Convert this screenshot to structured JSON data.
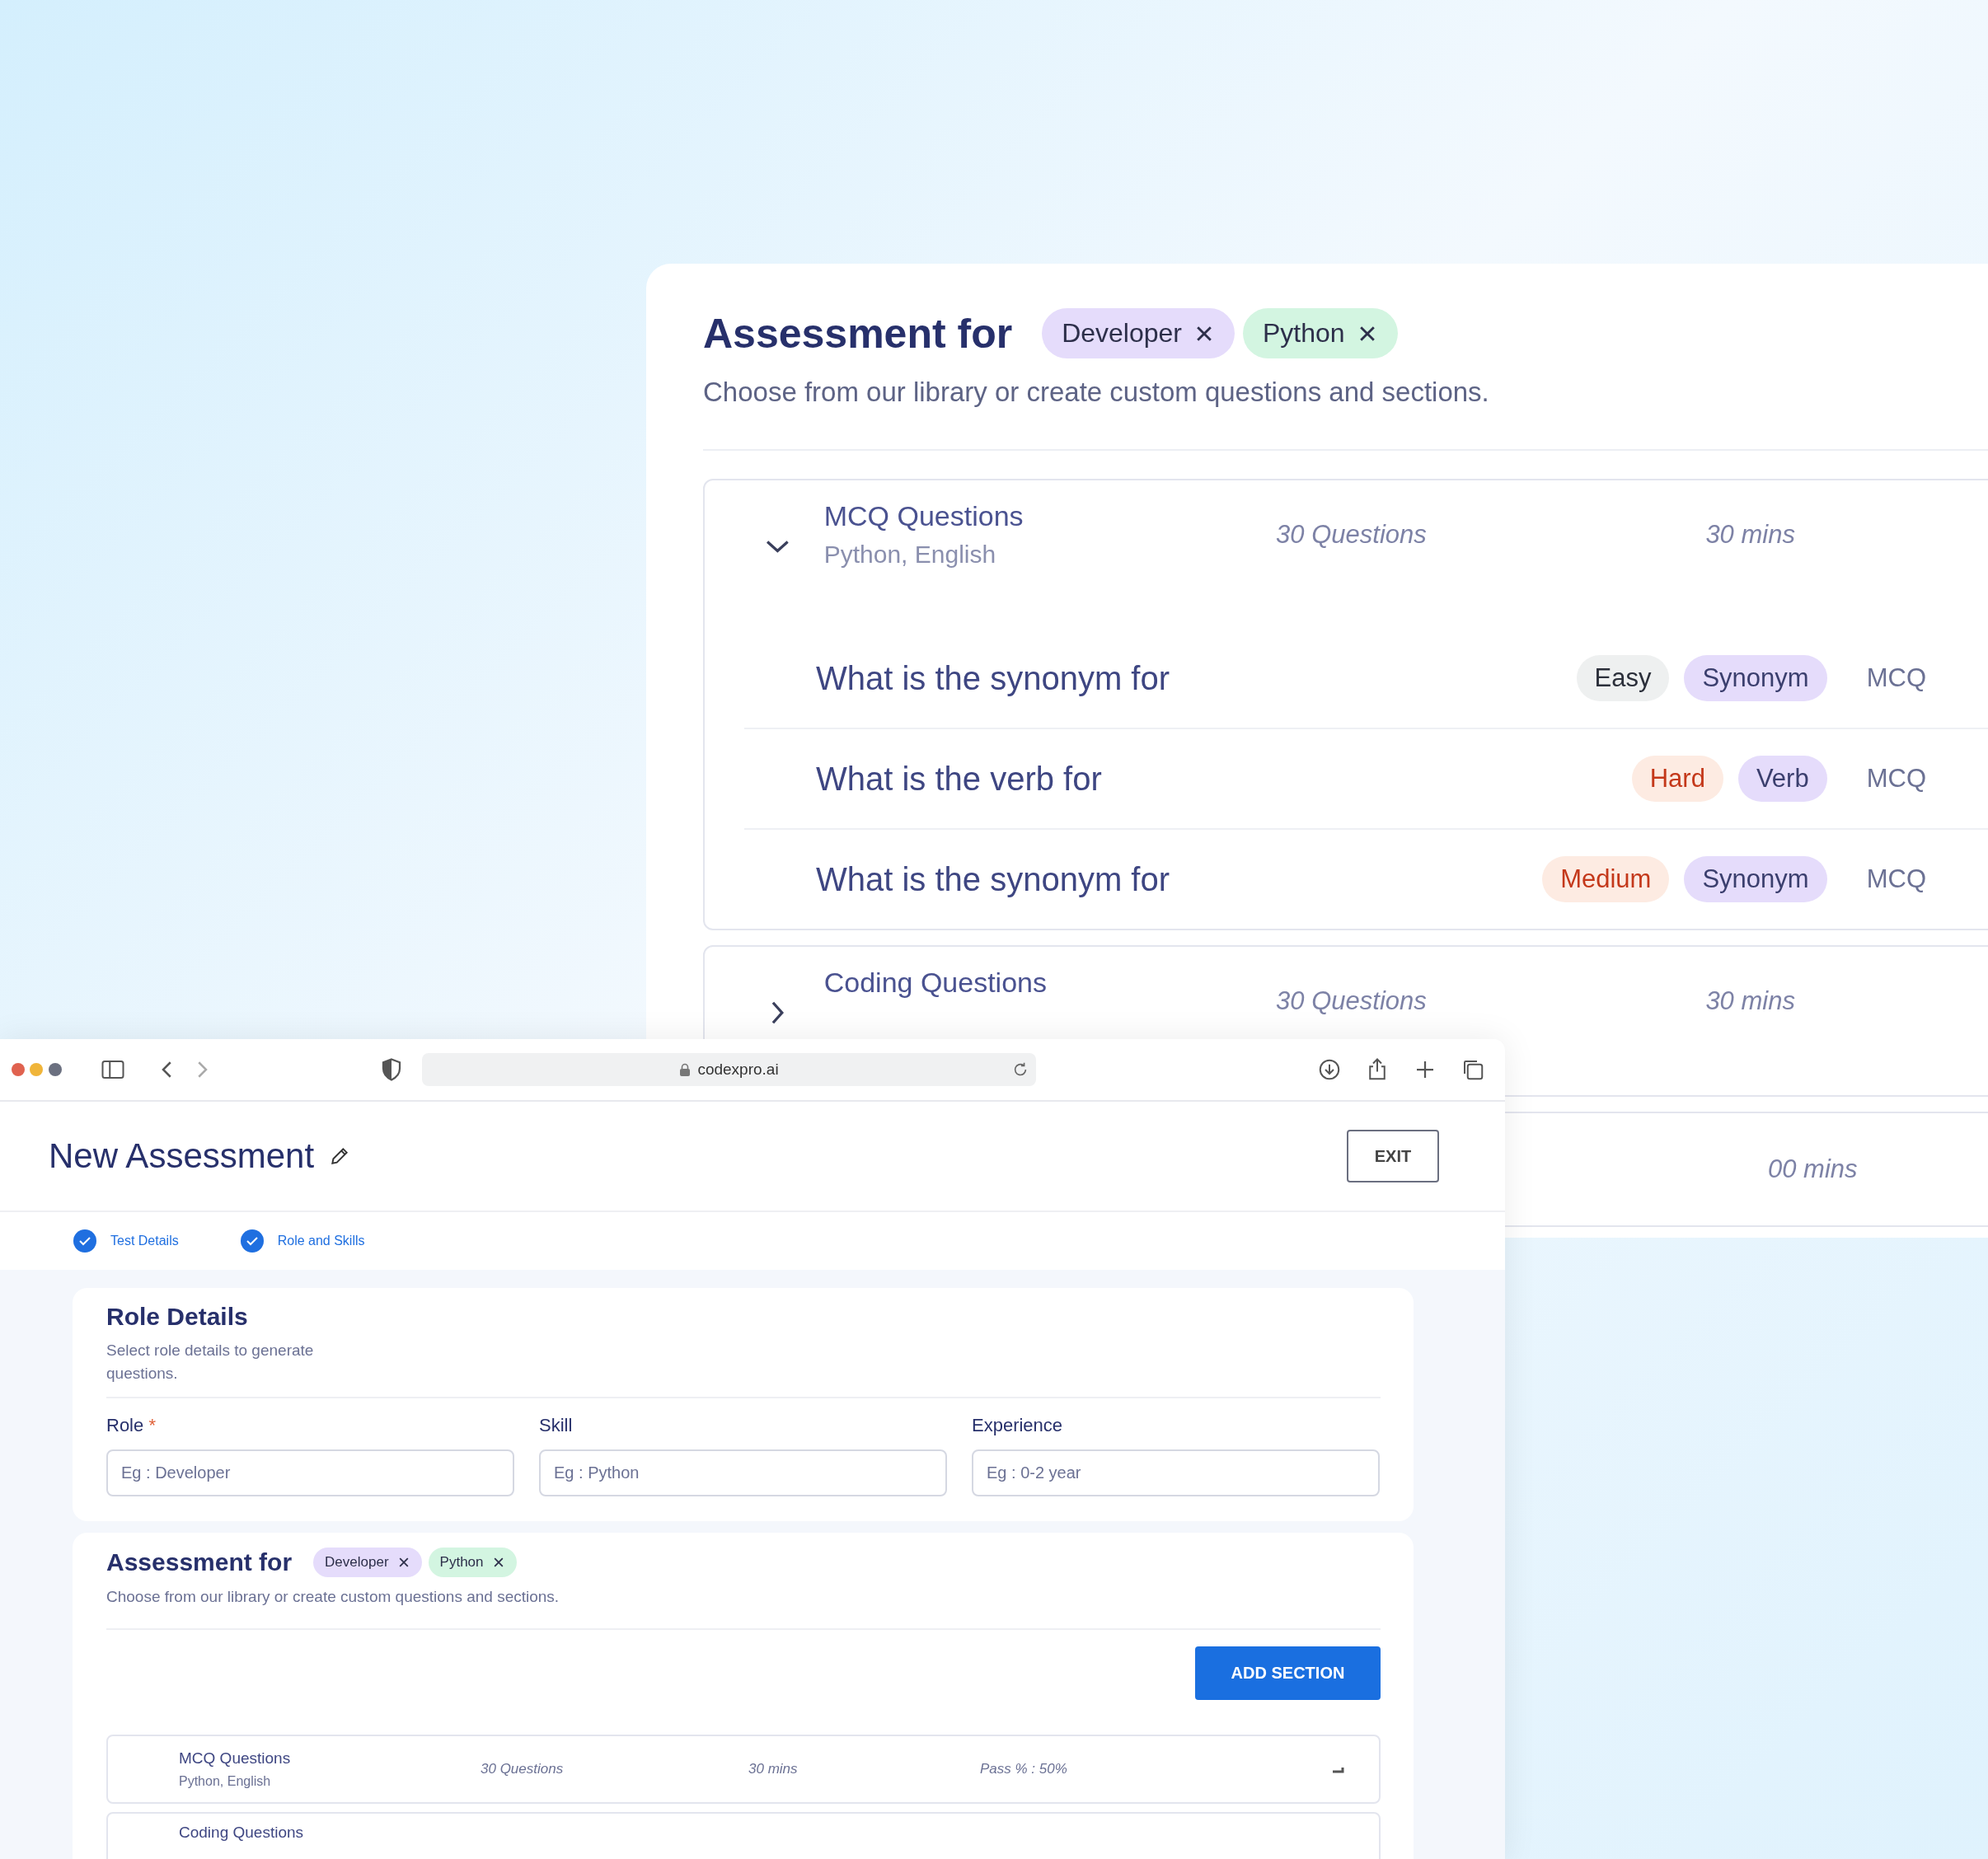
{
  "back_panel": {
    "title": "Assessment for",
    "chips": [
      {
        "label": "Developer",
        "color": "#e5dcfb"
      },
      {
        "label": "Python",
        "color": "#d3f5e1"
      }
    ],
    "subtitle": "Choose from our library or create custom questions and sections.",
    "sections": [
      {
        "title": "MCQ Questions",
        "subtitle": "Python, English",
        "expanded": true,
        "questions_count": "30 Questions",
        "duration": "30 mins",
        "questions": [
          {
            "text": "What is the synonym for",
            "difficulty": {
              "label": "Easy",
              "kind": "easy"
            },
            "tag": "Synonym",
            "type": "MCQ"
          },
          {
            "text": "What is the verb for",
            "difficulty": {
              "label": "Hard",
              "kind": "hard"
            },
            "tag": "Verb",
            "type": "MCQ"
          },
          {
            "text": "What is the synonym for",
            "difficulty": {
              "label": "Medium",
              "kind": "medium"
            },
            "tag": "Synonym",
            "type": "MCQ"
          }
        ]
      },
      {
        "title": "Coding Questions",
        "expanded": false,
        "questions_count": "30 Questions",
        "duration": "30 mins"
      },
      {
        "duration": "00 mins"
      }
    ]
  },
  "browser": {
    "url": "codexpro.ai"
  },
  "page": {
    "title": "New Assessment",
    "exit_button": "EXIT",
    "steps": [
      {
        "label": "Test Details",
        "done": true
      },
      {
        "label": "Role and Skills",
        "done": true
      }
    ],
    "role_details": {
      "title": "Role Details",
      "subtitle": "Select role details to generate questions.",
      "fields": [
        {
          "label": "Role",
          "required_mark": "*",
          "placeholder": "Eg : Developer"
        },
        {
          "label": "Skill",
          "placeholder": "Eg : Python"
        },
        {
          "label": "Experience",
          "placeholder": "Eg : 0-2 year"
        }
      ]
    },
    "assessment": {
      "title": "Assessment for",
      "chips": [
        {
          "label": "Developer",
          "color": "#e5dcfb"
        },
        {
          "label": "Python",
          "color": "#d3f5e1"
        }
      ],
      "subtitle": "Choose from our library or create custom questions and sections.",
      "add_button": "ADD SECTION",
      "sections": [
        {
          "title": "MCQ Questions",
          "subtitle": "Python, English",
          "questions_count": "30 Questions",
          "duration": "30 mins",
          "pass": "Pass % : 50%"
        },
        {
          "title": "Coding Questions"
        }
      ]
    }
  }
}
